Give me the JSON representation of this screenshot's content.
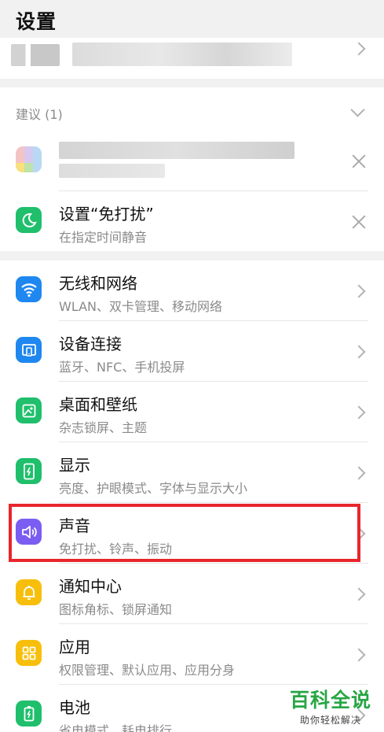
{
  "header": {
    "title": "设置"
  },
  "suggestions": {
    "header": "建议 (1)"
  },
  "suggestion_dnd": {
    "title": "设置“免打扰”",
    "subtitle": "在指定时间静音"
  },
  "items": [
    {
      "label": "无线和网络",
      "subtitle": "WLAN、双卡管理、移动网络",
      "icon": "wifi-icon",
      "color": "#1f87f0"
    },
    {
      "label": "设备连接",
      "subtitle": "蓝牙、NFC、手机投屏",
      "icon": "device-connection-icon",
      "color": "#1f87f0"
    },
    {
      "label": "桌面和壁纸",
      "subtitle": "杂志锁屏、主题",
      "icon": "wallpaper-icon",
      "color": "#1fbf6c"
    },
    {
      "label": "显示",
      "subtitle": "亮度、护眼模式、字体与显示大小",
      "icon": "display-icon",
      "color": "#1fbf6c"
    },
    {
      "label": "声音",
      "subtitle": "免打扰、铃声、振动",
      "icon": "sound-icon",
      "color": "#7b5df2"
    },
    {
      "label": "通知中心",
      "subtitle": "图标角标、锁屏通知",
      "icon": "bell-icon",
      "color": "#f7bf0c"
    },
    {
      "label": "应用",
      "subtitle": "权限管理、默认应用、应用分身",
      "icon": "apps-icon",
      "color": "#f7bf0c"
    },
    {
      "label": "电池",
      "subtitle": "省电模式、耗电排行",
      "icon": "battery-icon",
      "color": "#1fbf6c"
    }
  ],
  "watermark": {
    "title": "百科全说",
    "subtitle": "助你轻松解决"
  }
}
